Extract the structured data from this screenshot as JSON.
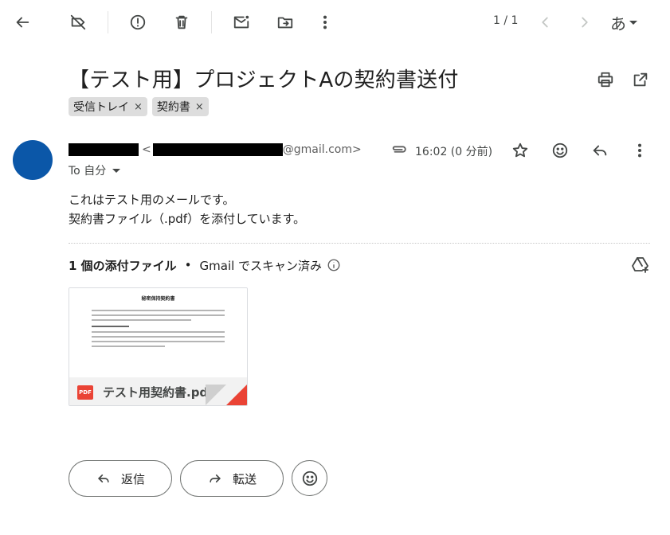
{
  "toolbar": {
    "pager": "1 / 1",
    "ime_char": "あ"
  },
  "email": {
    "subject": "【テスト用】プロジェクトAの契約書送付",
    "labels": [
      {
        "name": "受信トレイ",
        "remove": "×"
      },
      {
        "name": "契約書",
        "remove": "×"
      }
    ],
    "sender": {
      "email_open": "<",
      "email_suffix": "@gmail.com>"
    },
    "recipient": "To 自分",
    "time": "16:02 (0 分前)",
    "body_lines": [
      "これはテスト用のメールです。",
      "契約書ファイル（.pdf）を添付しています。"
    ]
  },
  "attachments": {
    "count_label": "1 個の添付ファイル",
    "separator": "•",
    "scan_label": "Gmail でスキャン済み",
    "items": [
      {
        "file_name": "テスト用契約書.pdf",
        "type_badge": "PDF",
        "preview_title": "秘密保持契約書"
      }
    ]
  },
  "actions": {
    "reply_label": "返信",
    "forward_label": "転送"
  },
  "colors": {
    "avatar": "#0b57a8",
    "pdf_red": "#ea4335"
  }
}
